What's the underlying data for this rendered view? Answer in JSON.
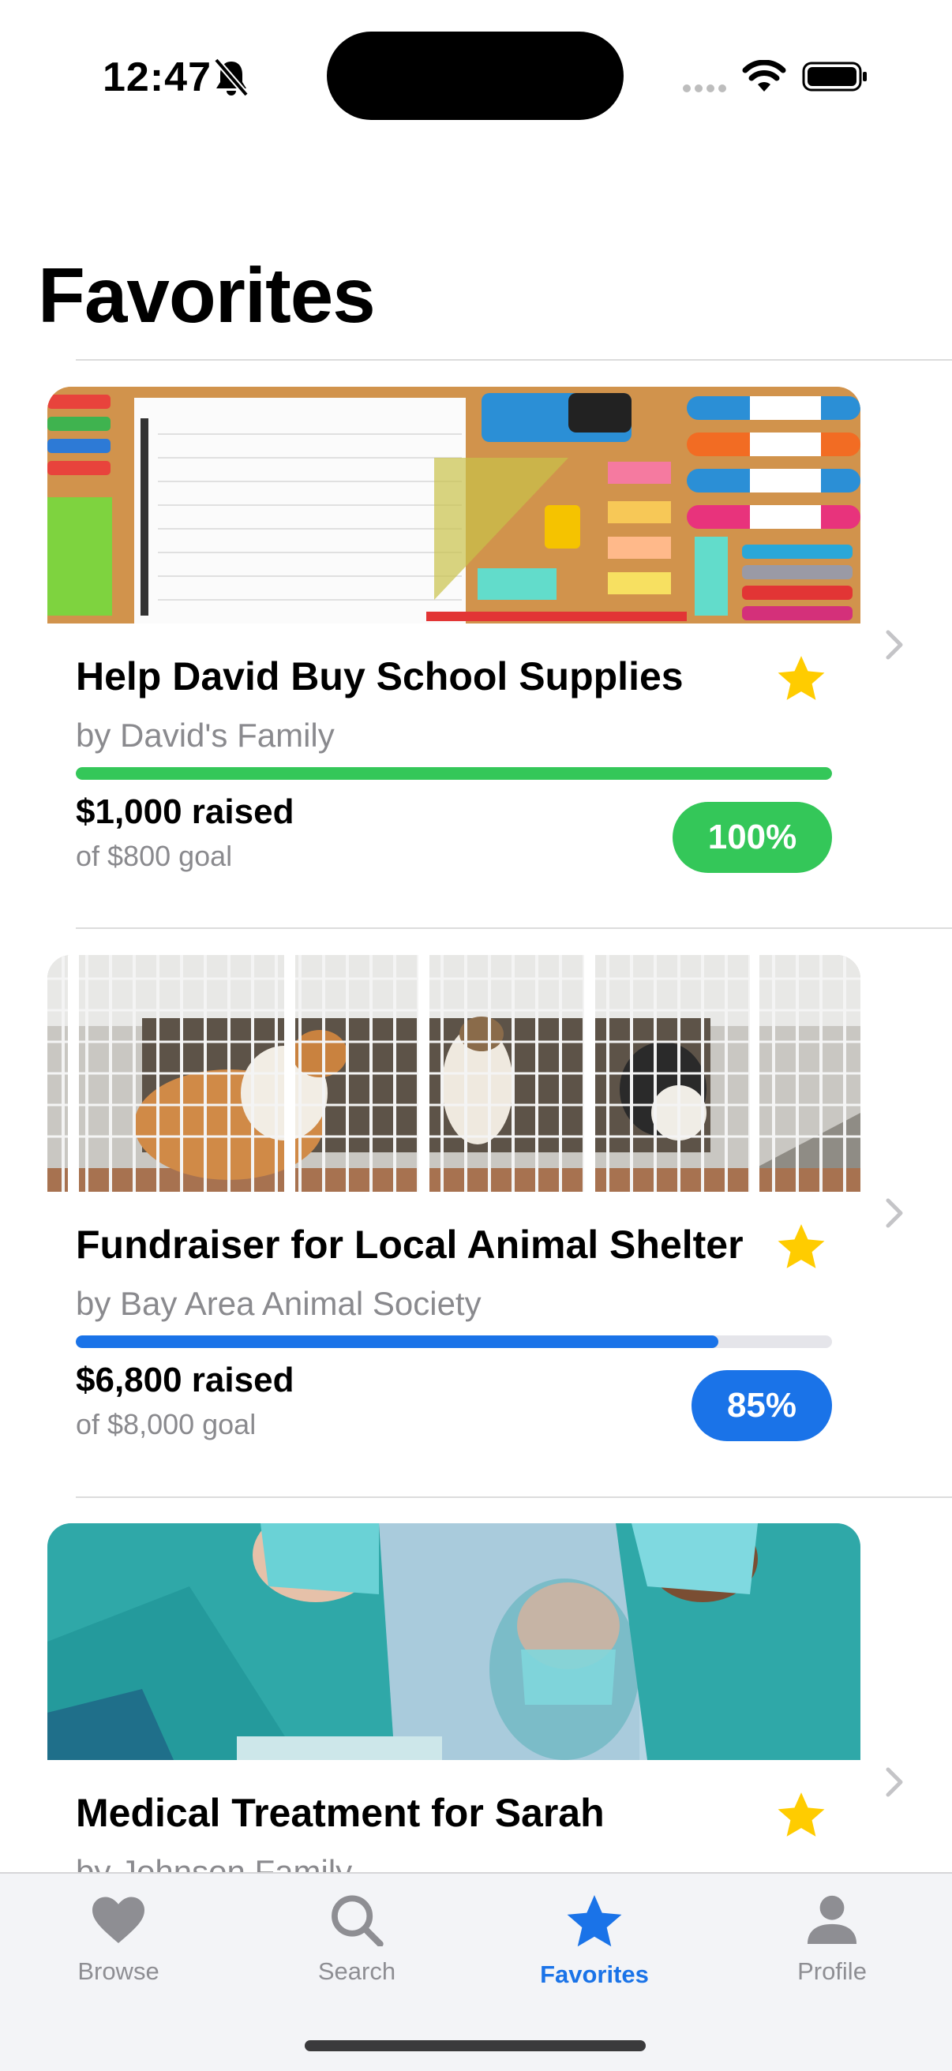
{
  "status_bar": {
    "time": "12:47",
    "icons": [
      "bell-slash-icon",
      "cellular-signal-icon",
      "wifi-icon",
      "battery-icon"
    ]
  },
  "page_title": "Favorites",
  "colors": {
    "accent": "#1a73e8",
    "success": "#34c759",
    "progress_blue": "#1a73e8",
    "star": "#ffcc00",
    "secondary_text": "#8a8a8e"
  },
  "campaigns": [
    {
      "title": "Help David Buy School Supplies",
      "organizer": "by David's Family",
      "raised": "$1,000 raised",
      "goal": "of $800 goal",
      "percent_label": "100%",
      "progress": 1.0,
      "favorited": true,
      "image": "school-supplies-photo"
    },
    {
      "title": "Fundraiser for Local Animal Shelter",
      "organizer": "by Bay Area Animal Society",
      "raised": "$6,800 raised",
      "goal": "of $8,000 goal",
      "percent_label": "85%",
      "progress": 0.85,
      "favorited": true,
      "image": "dogs-in-kennels-photo"
    },
    {
      "title": "Medical Treatment for Sarah",
      "organizer": "by Johnson Family",
      "favorited": true,
      "image": "surgeons-photo"
    }
  ],
  "tab_bar": {
    "tabs": [
      {
        "label": "Browse",
        "icon": "heart-icon",
        "active": false
      },
      {
        "label": "Search",
        "icon": "magnifying-glass-icon",
        "active": false
      },
      {
        "label": "Favorites",
        "icon": "star-icon",
        "active": true
      },
      {
        "label": "Profile",
        "icon": "person-icon",
        "active": false
      }
    ]
  }
}
